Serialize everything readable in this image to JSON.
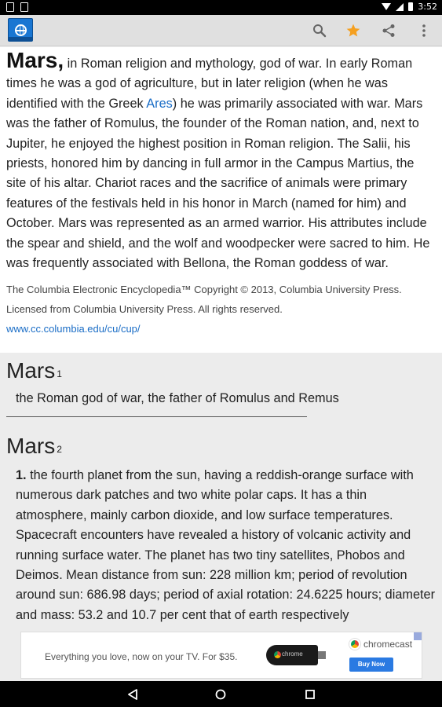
{
  "status_bar": {
    "time": "3:52",
    "icons": [
      "photo-icon",
      "sd-card-icon",
      "wifi-icon",
      "signal-icon",
      "battery-icon"
    ]
  },
  "toolbar": {
    "logo": "encyclopedia-globe-logo",
    "actions": [
      "search-icon",
      "star-icon",
      "share-icon",
      "more-vert-icon"
    ],
    "star_color": "#f5a020"
  },
  "entry1": {
    "headword": "Mars,",
    "text_before_link": " in Roman religion and mythology, god of war. In early Roman times he was a god of agriculture, but in later religion (when he was identified with the Greek ",
    "link_text": "Ares",
    "text_after_link": ") he was primarily associated with war. Mars was the father of Romulus, the founder of the Roman nation, and, next to Jupiter, he enjoyed the highest position in Roman religion. The Salii, his priests, honored him by dancing in full armor in the Campus Martius, the site of his altar. Chariot races and the sacrifice of animals were primary features of the festivals held in his honor in March (named for him) and October. Mars was represented as an armed warrior. His attributes include the spear and shield, and the wolf and woodpecker were sacred to him. He was frequently associated with Bellona, the Roman goddess of war.",
    "copyright": "The Columbia Electronic Encyclopedia™ Copyright © 2013, Columbia University Press. Licensed from Columbia University Press. All rights reserved.",
    "link": "www.cc.columbia.edu/cu/cup/"
  },
  "entry2": {
    "headword": "Mars",
    "superscript": "1",
    "definition": "the Roman god of war, the father of Romulus and Remus"
  },
  "entry3": {
    "headword": "Mars",
    "superscript": "2",
    "sense_number": "1.",
    "sense_text": " the fourth planet from the sun, having a reddish-orange surface with numerous dark patches and two white polar caps. It has a thin atmosphere, mainly carbon dioxide, and low surface temperatures. Spacecraft encounters have revealed a history of volcanic activity and running surface water. The planet has two tiny satellites, Phobos and Deimos. Mean distance from sun: 228 million km; period of revolution around sun: 686.98 days; period of axial rotation: 24.6225 hours; diameter and mass: 53.2 and 10.7 per cent that of earth respectively"
  },
  "ad": {
    "tagline": "Everything you love, now on your TV. For $35.",
    "dongle_label": "chrome",
    "brand": "chromecast",
    "button": "Buy Now"
  },
  "nav": {
    "buttons": [
      "back-icon",
      "home-icon",
      "recents-icon"
    ]
  }
}
